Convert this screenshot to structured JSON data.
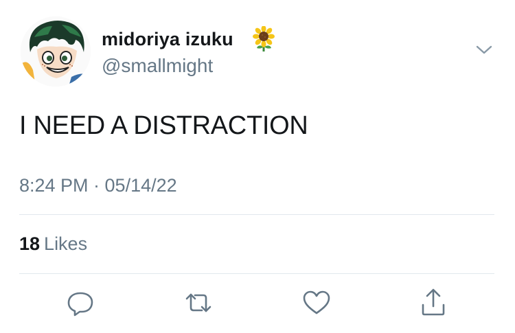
{
  "tweet": {
    "author": {
      "display_name": "midoriya izuku",
      "emoji": "sunflower-emoji",
      "handle": "@smallmight"
    },
    "text": "I NEED A DISTRACTION",
    "timestamp": "8:24 PM · 05/14/22",
    "likes": {
      "count": "18",
      "label": "Likes"
    },
    "actions": [
      "reply-icon",
      "retweet-icon",
      "like-icon",
      "share-icon"
    ]
  },
  "colors": {
    "primary_text": "#14171a",
    "secondary_text": "#657786",
    "divider": "#e1e8ed",
    "icon": "#657786"
  }
}
